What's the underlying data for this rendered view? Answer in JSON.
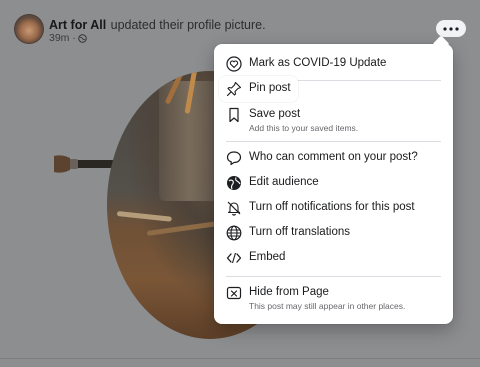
{
  "post": {
    "page_name": "Art for All",
    "action": "updated their profile picture.",
    "time": "39m ·"
  },
  "menu": {
    "items": [
      {
        "label": "Mark as COVID-19 Update",
        "icon": "heart-outline-icon"
      },
      {
        "label": "Pin post",
        "icon": "pin-icon"
      },
      {
        "label": "Save post",
        "sub": "Add this to your saved items.",
        "icon": "bookmark-icon"
      },
      {
        "label": "Who can comment on your post?",
        "icon": "comment-icon"
      },
      {
        "label": "Edit audience",
        "icon": "globe-icon"
      },
      {
        "label": "Turn off notifications for this post",
        "icon": "bell-off-icon"
      },
      {
        "label": "Turn off translations",
        "icon": "translate-icon"
      },
      {
        "label": "Embed",
        "icon": "code-icon"
      },
      {
        "label": "Hide from Page",
        "sub": "This post may still appear in other places.",
        "icon": "hide-box-icon"
      }
    ]
  },
  "colors": {
    "overlay": "#8d8e90",
    "menu_bg": "#ffffff",
    "text": "#1a1b1d",
    "subtext": "#65676b"
  }
}
